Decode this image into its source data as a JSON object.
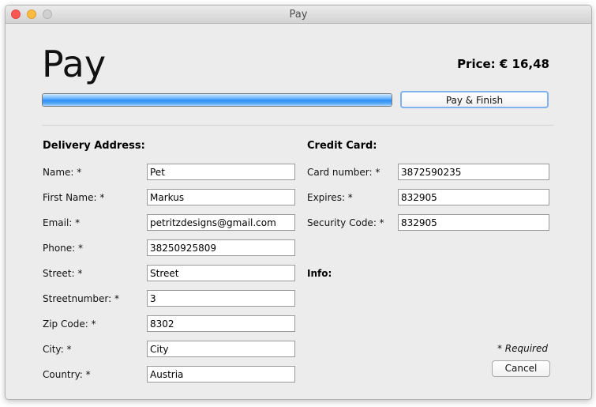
{
  "window": {
    "title": "Pay"
  },
  "header": {
    "title": "Pay",
    "price": "Price: € 16,48",
    "progress": 1.0,
    "pay_button": "Pay & Finish"
  },
  "delivery": {
    "title": "Delivery Address:",
    "fields": [
      {
        "label": "Name: *",
        "value": "Pet"
      },
      {
        "label": "First Name: *",
        "value": "Markus"
      },
      {
        "label": "Email: *",
        "value": "petritzdesigns@gmail.com"
      },
      {
        "label": "Phone: *",
        "value": "38250925809"
      },
      {
        "label": "Street: *",
        "value": "Street"
      },
      {
        "label": "Streetnumber: *",
        "value": "3"
      },
      {
        "label": "Zip Code: *",
        "value": "8302"
      },
      {
        "label": "City: *",
        "value": "City"
      },
      {
        "label": "Country: *",
        "value": "Austria"
      }
    ]
  },
  "card": {
    "title": "Credit Card:",
    "fields": [
      {
        "label": "Card number: *",
        "value": "3872590235"
      },
      {
        "label": "Expires: *",
        "value": "832905"
      },
      {
        "label": "Security Code: *",
        "value": "832905"
      }
    ],
    "info_label": "Info:"
  },
  "footer": {
    "required_note": "* Required",
    "cancel_button": "Cancel"
  }
}
